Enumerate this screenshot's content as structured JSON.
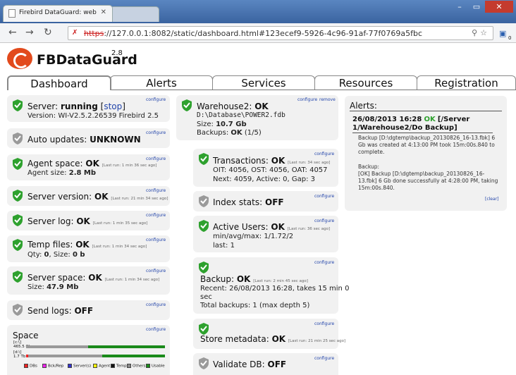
{
  "browser": {
    "tab_title": "Firebird DataGuard: web-c",
    "url_scheme": "https",
    "url_rest": "://127.0.0.1:8082/static/dashboard.html#123ecef9-5926-4c96-91af-77f0769a5fbc",
    "extension_badge": "0"
  },
  "app": {
    "name": "FBDataGuard",
    "version": "2.8"
  },
  "tabs": [
    "Dashboard",
    "Alerts",
    "Services",
    "Resources",
    "Registration"
  ],
  "configure": "configure",
  "remove": "remove",
  "left": {
    "server": {
      "title": "Server:",
      "status": "running",
      "open": "[",
      "stop": "stop",
      "close": "]",
      "version": "Version: WI-V2.5.2.26539 Firebird 2.5"
    },
    "autoupdates": {
      "title": "Auto updates:",
      "status": "UNKNOWN"
    },
    "agentspace": {
      "title": "Agent space:",
      "status": "OK",
      "lastrun": "[Last run: 1 min 36 sec ago]",
      "detail_label": "Agent size:",
      "detail_value": "2.8 Mb"
    },
    "serverversion": {
      "title": "Server version:",
      "status": "OK",
      "lastrun": "[Last run: 21 min 34 sec ago]"
    },
    "serverlog": {
      "title": "Server log:",
      "status": "OK",
      "lastrun": "[Last run: 1 min 35 sec ago]"
    },
    "tempfiles": {
      "title": "Temp files:",
      "status": "OK",
      "lastrun": "[Last run: 1 min 34 sec ago]",
      "qty_label": "Qty:",
      "qty": "0",
      "size_label": ", Size:",
      "size": "0 b"
    },
    "serverspace": {
      "title": "Server space:",
      "status": "OK",
      "lastrun": "[Last run: 1 min 34 sec ago]",
      "detail_label": "Size:",
      "detail_value": "47.9 Mb"
    },
    "sendlogs": {
      "title": "Send logs:",
      "status": "OFF"
    },
    "space": {
      "title": "Space",
      "drive1": "[c:\\]",
      "drive1_size": "465.5 Gb",
      "drive2": "[d:\\]",
      "drive2_size": "1.7 Tb",
      "legend": [
        "DBs",
        "Bck/Rep",
        "Server(s)",
        "Agent",
        "Temp",
        "Others",
        "Usable"
      ]
    }
  },
  "mid": {
    "warehouse": {
      "title": "Warehouse2:",
      "status": "OK",
      "path": "D:\\Database\\POWER2.fdb",
      "size_label": "Size:",
      "size": "10.7 Gb",
      "backups_label": "Backups:",
      "backups": "OK",
      "backups_count": "(1/5)"
    },
    "transactions": {
      "title": "Transactions:",
      "status": "OK",
      "lastrun": "[Last run: 34 sec ago]",
      "line1": "OIT: 4056, OST: 4056, OAT: 4057",
      "line2": "Next: 4059, Active: 0, Gap: 3"
    },
    "indexstats": {
      "title": "Index stats:",
      "status": "OFF"
    },
    "activeusers": {
      "title": "Active Users:",
      "status": "OK",
      "lastrun": "[Last run: 36 sec ago]",
      "line1": "min/avg/max:  1/1.72/2",
      "line2": "last:  1"
    },
    "backup": {
      "title": "Backup:",
      "status": "OK",
      "lastrun": "[Last run: 2 min 45 sec ago]",
      "line1": "Recent: 26/08/2013 16:28, takes 15 min 0",
      "line2": "sec",
      "line3": "Total backups: 1 (max depth 5)"
    },
    "storemeta": {
      "title": "Store metadata:",
      "status": "OK",
      "lastrun": "[Last run: 21 min 25 sec ago]"
    },
    "validatedb": {
      "title": "Validate DB:",
      "status": "OFF"
    }
  },
  "alerts": {
    "title": "Alerts:",
    "time": "26/08/2013 16:28",
    "level": "OK",
    "source": "[/Server 1/Warehouse2/Do Backup]",
    "message1": "Backup [D:\\dgtemp\\backup_20130826_16-13.fbk] 6 Gb was created at 4:13:00 PM took 15m:00s.840 to complete.",
    "message2": "Backup:",
    "message3": "[OK] Backup [D:\\dgtemp\\backup_20130826_16-13.fbk] 6 Gb done successfully at 4:28:00 PM, taking 15m:00s.840.",
    "clear": "[clear]"
  },
  "colors": {
    "ok_green": "#2ea12e",
    "unknown_gray": "#9a9a9a",
    "link_blue": "#2244aa",
    "chrome_blue": "#3a63a0"
  }
}
